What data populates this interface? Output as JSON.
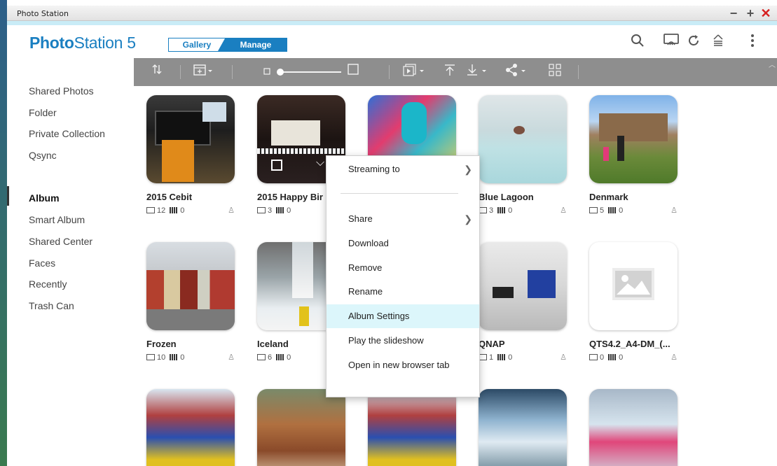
{
  "window": {
    "title": "Photo Station",
    "minimize": "−",
    "maximize": "+",
    "close": "✕"
  },
  "header": {
    "logo_bold": "Photo",
    "logo_regular": "Station 5",
    "mode_gallery": "Gallery",
    "mode_manage": "Manage",
    "icons": [
      "search-icon",
      "cast-icon",
      "refresh-icon",
      "upload-queue-icon",
      "more-icon"
    ]
  },
  "toolbar": {
    "icons": [
      "sort-icon",
      "add-icon",
      "zoom-slider",
      "slideshow-icon",
      "upload-icon",
      "download-icon",
      "share-icon",
      "grid-view-icon"
    ]
  },
  "sidebar": {
    "items": [
      {
        "label": "Shared Photos"
      },
      {
        "label": "Folder"
      },
      {
        "label": "Private Collection"
      },
      {
        "label": "Qsync"
      },
      {
        "label": "Album"
      },
      {
        "label": "Smart Album"
      },
      {
        "label": "Shared Center"
      },
      {
        "label": "Faces"
      },
      {
        "label": "Recently"
      },
      {
        "label": "Trash Can"
      }
    ],
    "active": "Album"
  },
  "albums": [
    {
      "name": "2015 Cebit",
      "photos": "12",
      "videos": "0"
    },
    {
      "name": "2015 Happy Bir",
      "photos": "3",
      "videos": "0"
    },
    {
      "name": "",
      "photos": "",
      "videos": ""
    },
    {
      "name": "Blue Lagoon",
      "photos": "3",
      "videos": "0"
    },
    {
      "name": "Denmark",
      "photos": "5",
      "videos": "0"
    },
    {
      "name": "Frozen",
      "photos": "10",
      "videos": "0"
    },
    {
      "name": "Iceland",
      "photos": "6",
      "videos": "0"
    },
    {
      "name": "",
      "photos": "",
      "videos": ""
    },
    {
      "name": "QNAP",
      "photos": "1",
      "videos": "0"
    },
    {
      "name": "QTS4.2_A4-DM_(...",
      "photos": "0",
      "videos": "0"
    }
  ],
  "context_menu": {
    "streaming": "Streaming to",
    "share": "Share",
    "download": "Download",
    "remove": "Remove",
    "rename": "Rename",
    "album_settings": "Album Settings",
    "slideshow": "Play the slideshow",
    "open_tab": "Open in new browser tab"
  },
  "colors": {
    "brand": "#1a7fc1",
    "toolbar": "#8e8e8e",
    "menu_highlight": "#dcf6fb",
    "close": "#d62020"
  }
}
